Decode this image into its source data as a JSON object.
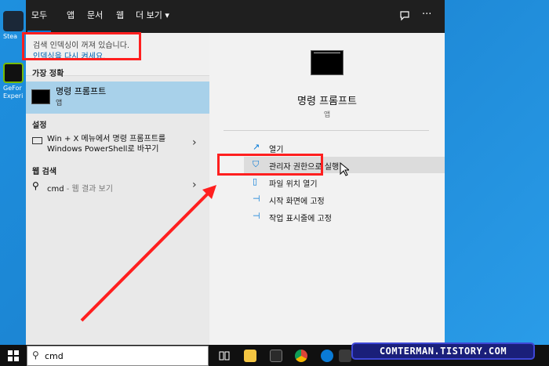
{
  "tabs": [
    "모두",
    "앱",
    "문서",
    "웹",
    "더 보기 ▾"
  ],
  "notice": {
    "line1": "검색 인덱싱이 꺼져 있습니다.",
    "line2": "인덱싱을 다시 켜세요."
  },
  "sections": {
    "best": "가장 정확",
    "settings": "설정",
    "web": "웹 검색"
  },
  "best_match": {
    "name": "명령 프롬프트",
    "sub": "앱"
  },
  "setting_item": {
    "line1": "Win + X 메뉴에서 명령 프롬프트를",
    "line2": "Windows PowerShell로 바꾸기"
  },
  "web_item": {
    "query": "cmd",
    "hint": " - 웹 결과 보기"
  },
  "preview": {
    "title": "명령 프롬프트",
    "sub": "앱"
  },
  "actions": [
    {
      "icon": "open-icon",
      "label": "열기"
    },
    {
      "icon": "admin-shield-icon",
      "label": "관리자 권한으로 실행"
    },
    {
      "icon": "folder-icon",
      "label": "파일 위치 열기"
    },
    {
      "icon": "pin-icon",
      "label": "시작 화면에 고정"
    },
    {
      "icon": "pin-icon",
      "label": "작업 표시줄에 고정"
    }
  ],
  "desktop_icons": [
    "Stea",
    "GeFor Experi"
  ],
  "search": {
    "value": "cmd"
  },
  "watermark": "COMTERMAN.TISTORY.COM",
  "colors": {
    "accent": "#0078d7",
    "highlight": "#ff1f1f",
    "selected_row": "#a8d1ea"
  }
}
